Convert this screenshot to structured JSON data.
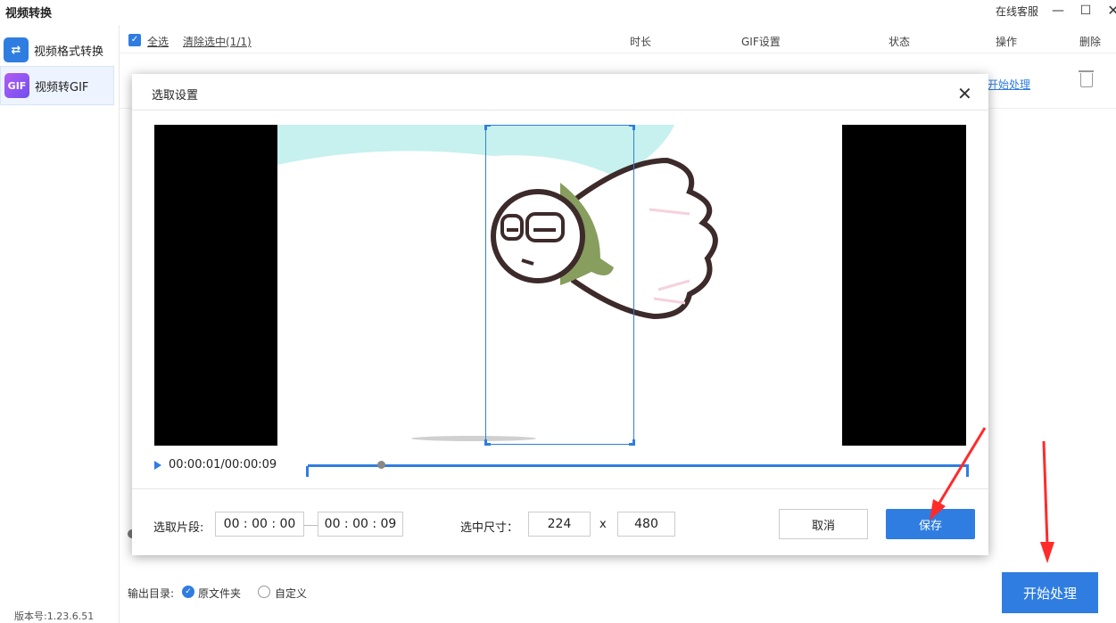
{
  "app": {
    "title": "视频转换",
    "support": "在线客服",
    "version": "版本号:1.23.6.51"
  },
  "sidebar": {
    "items": [
      {
        "label": "视频格式转换",
        "icon": "swap-arrows-icon"
      },
      {
        "label": "视频转GIF",
        "icon_text": "GIF",
        "icon": "gif-icon"
      }
    ]
  },
  "list": {
    "select_all": "全选",
    "clear_selection": "清除选中(1/1)",
    "columns": [
      "时长",
      "GIF设置",
      "状态",
      "操作",
      "删除"
    ],
    "row_action": "开始处理"
  },
  "output": {
    "label": "输出目录:",
    "options": [
      "原文件夹",
      "自定义"
    ],
    "selected": "原文件夹"
  },
  "start_button": "开始处理",
  "dialog": {
    "title": "选取设置",
    "time": "00:00:01/00:00:09",
    "segment_label": "选取片段:",
    "start_time": "00 : 00 : 00",
    "end_time": "00 : 00 : 09",
    "size_label": "选中尺寸：",
    "width": "224",
    "height": "480",
    "x_sep": "x",
    "cancel": "取消",
    "save": "保存",
    "playback_position": 0.11
  },
  "colors": {
    "accent": "#2f7de1",
    "arrow": "#ff2b2b"
  }
}
